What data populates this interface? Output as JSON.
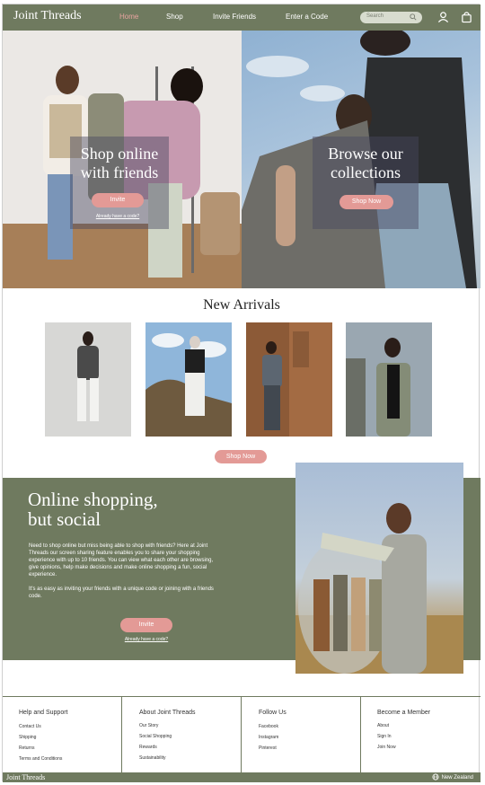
{
  "header": {
    "logo": "Joint Threads",
    "nav": [
      "Home",
      "Shop",
      "Invite Friends",
      "Enter a Code"
    ],
    "search_placeholder": "Search",
    "colors": {
      "bar": "#6f7a5f",
      "accent": "#e39a96"
    }
  },
  "hero": {
    "left": {
      "title_line1": "Shop online",
      "title_line2": "with friends",
      "button": "Invite",
      "link": "Already have a code?"
    },
    "right": {
      "title_line1": "Browse our",
      "title_line2": "collections",
      "button": "Shop Now"
    }
  },
  "new_arrivals": {
    "title": "New Arrivals",
    "button": "Shop Now"
  },
  "social": {
    "title_line1": "Online shopping,",
    "title_line2": "but social",
    "paragraph1": "Need to shop online but miss being able to shop with friends? Here at Joint Threads our screen sharing feature enables you to share your shopping experience with up to 10 friends. You can view what each other are browsing, give opinions, help make decisions and make online shopping a fun, social experience.",
    "paragraph2": "It's as easy as inviting your friends with a unique code or joining with a friends code.",
    "button": "Invite",
    "link": "Already have a code?"
  },
  "footer": {
    "columns": [
      {
        "title": "Help and Support",
        "links": [
          "Contact Us",
          "Shipping",
          "Returns",
          "Terms and Conditions"
        ]
      },
      {
        "title": "About Joint Threads",
        "links": [
          "Our Story",
          "Social Shopping",
          "Rewards",
          "Sustainability"
        ]
      },
      {
        "title": "Follow Us",
        "links": [
          "Facebook",
          "Instagram",
          "Pinterest"
        ]
      },
      {
        "title": "Become a Member",
        "links": [
          "About",
          "Sign In",
          "Join Now"
        ]
      }
    ],
    "bottom_logo": "Joint Threads",
    "region": "New Zealand"
  }
}
